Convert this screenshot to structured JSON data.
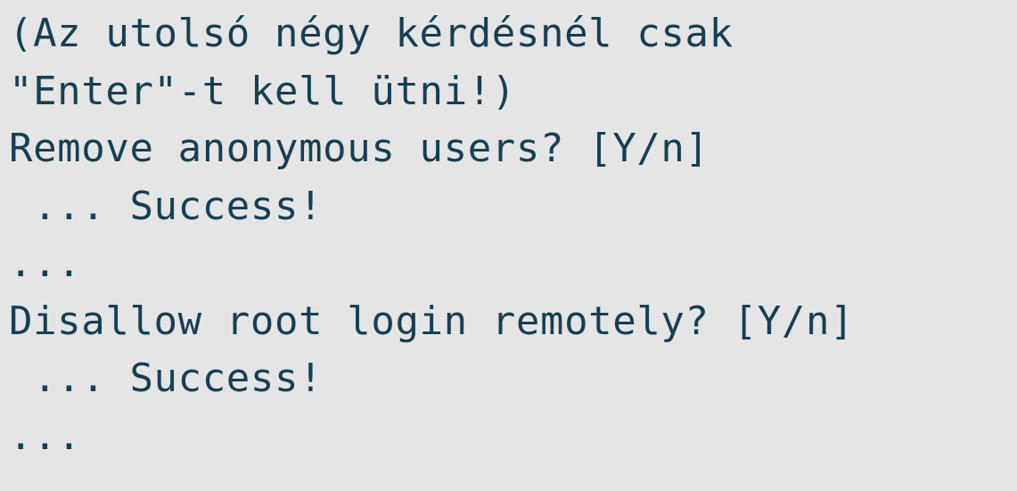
{
  "terminal": {
    "lines": [
      "(Az utolsó négy kérdésnél csak",
      "\"Enter\"-t kell ütni!)",
      "Remove anonymous users? [Y/n]",
      " ... Success!",
      "...",
      "Disallow root login remotely? [Y/n]",
      " ... Success!",
      "..."
    ]
  },
  "colors": {
    "background": "#e5e5e5",
    "text": "#173f52"
  }
}
